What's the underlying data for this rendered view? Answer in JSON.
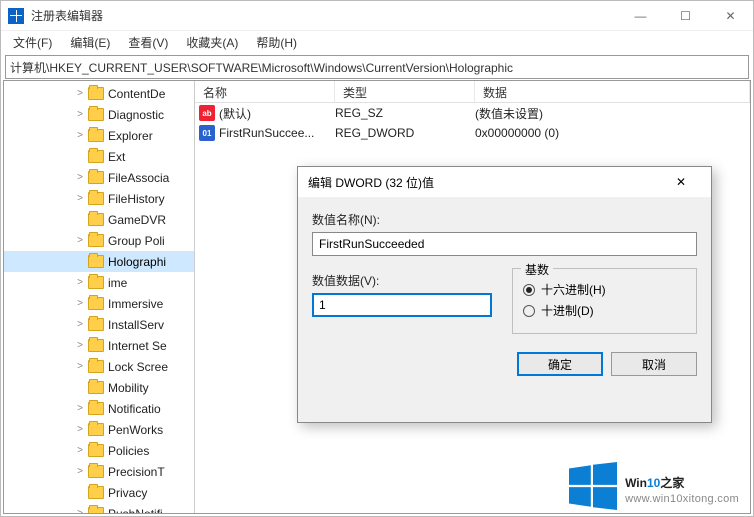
{
  "window": {
    "title": "注册表编辑器",
    "controls": {
      "min": "—",
      "max": "☐",
      "close": "✕"
    }
  },
  "menu": [
    "文件(F)",
    "编辑(E)",
    "查看(V)",
    "收藏夹(A)",
    "帮助(H)"
  ],
  "address": "计算机\\HKEY_CURRENT_USER\\SOFTWARE\\Microsoft\\Windows\\CurrentVersion\\Holographic",
  "tree": [
    {
      "label": "ContentDe",
      "indent": 70,
      "exp": ">"
    },
    {
      "label": "Diagnostic",
      "indent": 70,
      "exp": ">"
    },
    {
      "label": "Explorer",
      "indent": 70,
      "exp": ">"
    },
    {
      "label": "Ext",
      "indent": 70,
      "exp": ""
    },
    {
      "label": "FileAssocia",
      "indent": 70,
      "exp": ">"
    },
    {
      "label": "FileHistory",
      "indent": 70,
      "exp": ">"
    },
    {
      "label": "GameDVR",
      "indent": 70,
      "exp": ""
    },
    {
      "label": "Group Poli",
      "indent": 70,
      "exp": ">"
    },
    {
      "label": "Holographi",
      "indent": 70,
      "exp": "",
      "selected": true
    },
    {
      "label": "ime",
      "indent": 70,
      "exp": ">"
    },
    {
      "label": "Immersive",
      "indent": 70,
      "exp": ">"
    },
    {
      "label": "InstallServ",
      "indent": 70,
      "exp": ">"
    },
    {
      "label": "Internet Se",
      "indent": 70,
      "exp": ">"
    },
    {
      "label": "Lock Scree",
      "indent": 70,
      "exp": ">"
    },
    {
      "label": "Mobility",
      "indent": 70,
      "exp": ""
    },
    {
      "label": "Notificatio",
      "indent": 70,
      "exp": ">"
    },
    {
      "label": "PenWorks",
      "indent": 70,
      "exp": ">"
    },
    {
      "label": "Policies",
      "indent": 70,
      "exp": ">"
    },
    {
      "label": "PrecisionT",
      "indent": 70,
      "exp": ">"
    },
    {
      "label": "Privacy",
      "indent": 70,
      "exp": ""
    },
    {
      "label": "PushNotifi",
      "indent": 70,
      "exp": ">"
    }
  ],
  "list": {
    "headers": {
      "name": "名称",
      "type": "类型",
      "data": "数据"
    },
    "rows": [
      {
        "icon": "sz",
        "name": "(默认)",
        "type": "REG_SZ",
        "data": "(数值未设置)"
      },
      {
        "icon": "dw",
        "name": "FirstRunSuccee...",
        "type": "REG_DWORD",
        "data": "0x00000000 (0)"
      }
    ]
  },
  "dialog": {
    "title": "编辑 DWORD (32 位)值",
    "name_label": "数值名称(N):",
    "name_value": "FirstRunSucceeded",
    "data_label": "数值数据(V):",
    "data_value": "1",
    "base_label": "基数",
    "radio_hex": "十六进制(H)",
    "radio_dec": "十进制(D)",
    "ok": "确定",
    "cancel": "取消"
  },
  "watermark": {
    "brand1": "Win",
    "brand2": "10",
    "brand3": "之家",
    "url": "www.win10xitong.com"
  }
}
